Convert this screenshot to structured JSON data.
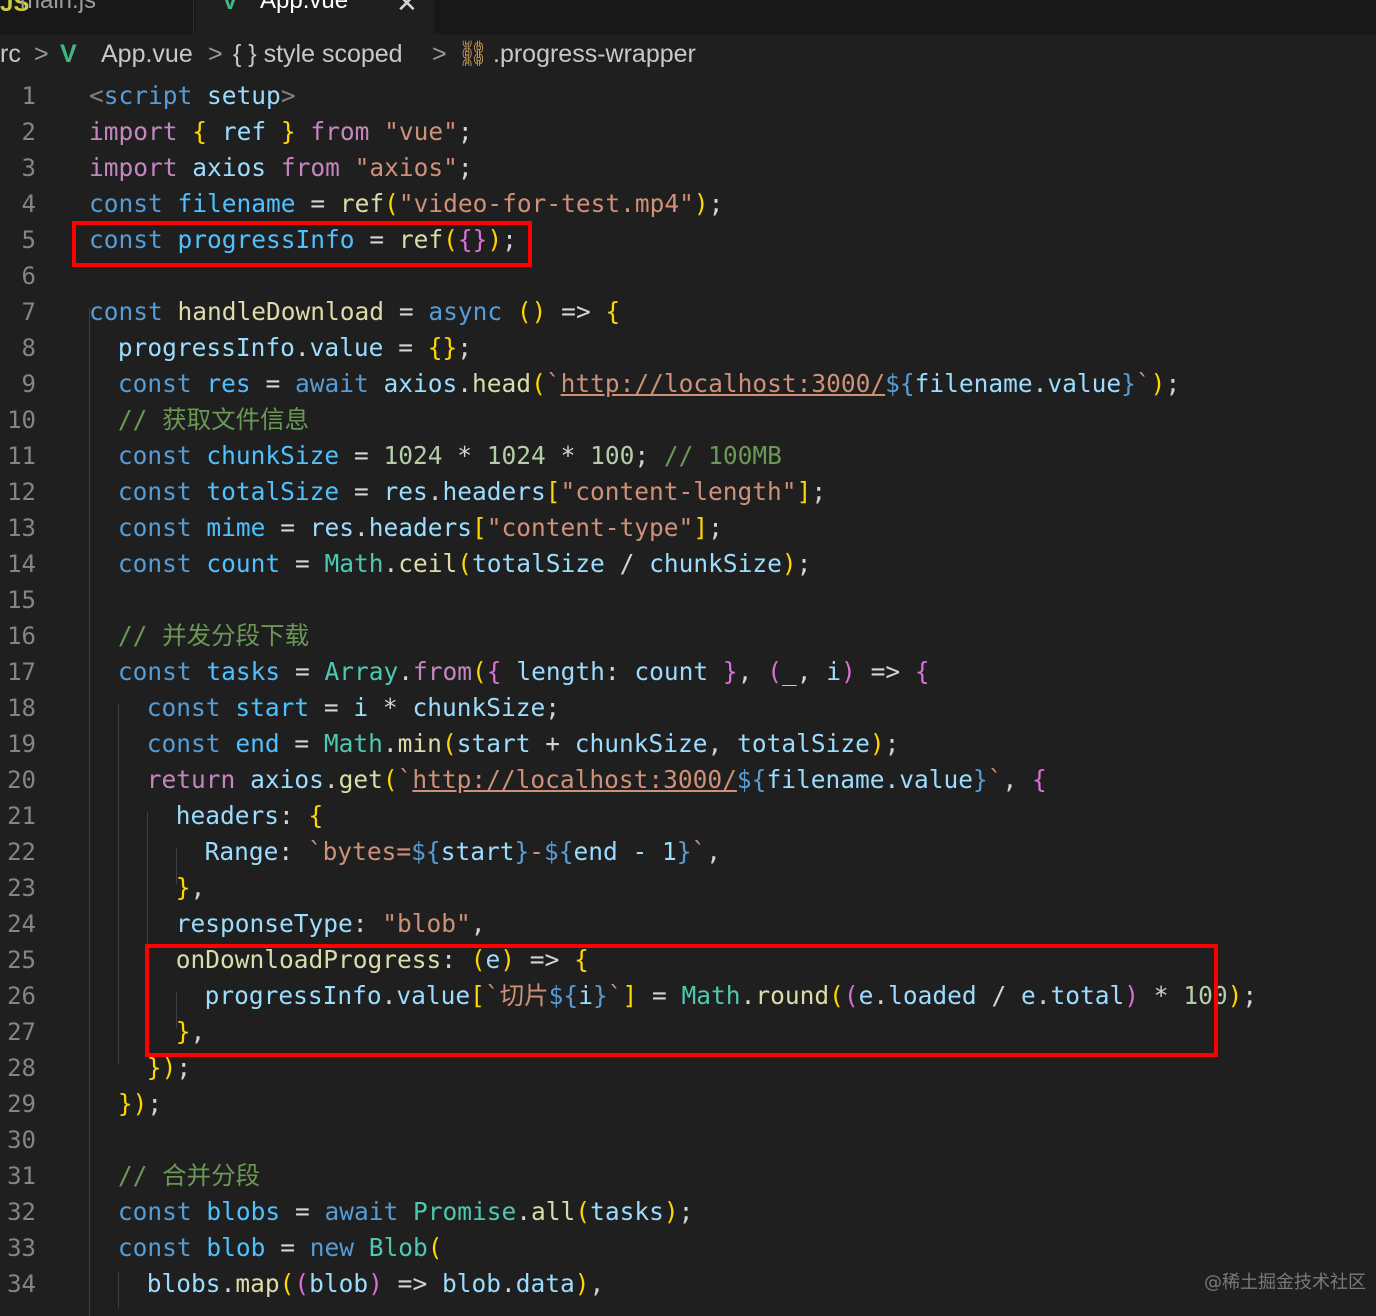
{
  "tabs": [
    {
      "label": "main.js",
      "icon": "javascript-file-icon",
      "active": false
    },
    {
      "label": "App.vue",
      "icon": "vue-file-icon",
      "active": true,
      "close": "✕"
    }
  ],
  "breadcrumb": {
    "root": "rc",
    "sep": ">",
    "file": "App.vue",
    "section": "{ } style scoped",
    "symbol": ".progress-wrapper"
  },
  "line_numbers": [
    "1",
    "2",
    "3",
    "4",
    "5",
    "6",
    "7",
    "8",
    "9",
    "10",
    "11",
    "12",
    "13",
    "14",
    "15",
    "16",
    "17",
    "18",
    "19",
    "20",
    "21",
    "22",
    "23",
    "24",
    "25",
    "26",
    "27",
    "28",
    "29",
    "30",
    "31",
    "32",
    "33",
    "34"
  ],
  "code_lines": [
    "<script setup>",
    "import { ref } from \"vue\";",
    "import axios from \"axios\";",
    "const filename = ref(\"video-for-test.mp4\");",
    "const progressInfo = ref({});",
    "",
    "const handleDownload = async () => {",
    "  progressInfo.value = {};",
    "  const res = await axios.head(`http://localhost:3000/${filename.value}`);",
    "  // 获取文件信息",
    "  const chunkSize = 1024 * 1024 * 100; // 100MB",
    "  const totalSize = res.headers[\"content-length\"];",
    "  const mime = res.headers[\"content-type\"];",
    "  const count = Math.ceil(totalSize / chunkSize);",
    "",
    "  // 并发分段下载",
    "  const tasks = Array.from({ length: count }, (_, i) => {",
    "    const start = i * chunkSize;",
    "    const end = Math.min(start + chunkSize, totalSize);",
    "    return axios.get(`http://localhost:3000/${filename.value}`, {",
    "      headers: {",
    "        Range: `bytes=${start}-${end - 1}`,",
    "      },",
    "      responseType: \"blob\",",
    "      onDownloadProgress: (e) => {",
    "        progressInfo.value[`切片${i}`] = Math.round((e.loaded / e.total) * 100);",
    "      },",
    "    });",
    "  });",
    "",
    "  // 合并分段",
    "  const blobs = await Promise.all(tasks);",
    "  const blob = new Blob(",
    "    blobs.map((blob) => blob.data),"
  ],
  "highlights": [
    "line 5: const progressInfo = ref({});",
    "lines 25-27: onDownloadProgress handler"
  ],
  "watermark": "@稀土掘金技术社区"
}
